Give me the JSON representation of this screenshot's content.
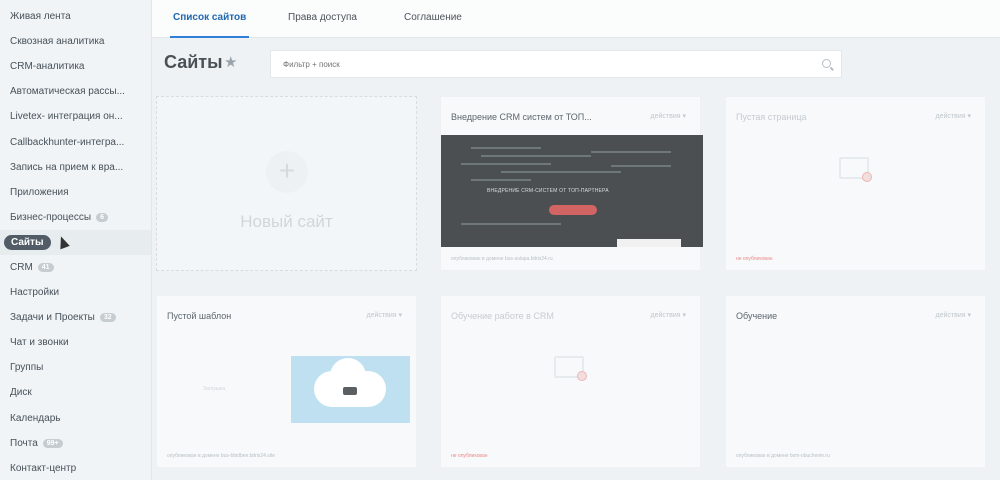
{
  "sidebar": {
    "items": [
      {
        "label": "Живая лента"
      },
      {
        "label": "Сквозная аналитика"
      },
      {
        "label": "CRM-аналитика"
      },
      {
        "label": "Автоматическая рассы..."
      },
      {
        "label": "Livetex- интеграция он..."
      },
      {
        "label": "Callbackhunter-интегра..."
      },
      {
        "label": "Запись на прием к вра..."
      },
      {
        "label": "Приложения"
      },
      {
        "label": "Бизнес-процессы",
        "badge": "6"
      },
      {
        "label": "Сайты"
      },
      {
        "label": "CRM",
        "badge": "41"
      },
      {
        "label": "Настройки"
      },
      {
        "label": "Задачи и Проекты",
        "badge": "32"
      },
      {
        "label": "Чат и звонки"
      },
      {
        "label": "Группы"
      },
      {
        "label": "Диск"
      },
      {
        "label": "Календарь"
      },
      {
        "label": "Почта",
        "badge": "99+"
      },
      {
        "label": "Контакт-центр"
      }
    ]
  },
  "tabs": {
    "list": "Список сайтов",
    "access": "Права доступа",
    "agreement": "Соглашение"
  },
  "page": {
    "title": "Сайты",
    "search_placeholder": "Фильтр + поиск"
  },
  "cards": {
    "new_site": "Новый сайт",
    "c1": {
      "title": "Внедрение CRM систем от ТОП...",
      "actions": "действия",
      "preview_text": "ВНЕДРЕНИЕ CRM-СИСТЕМ ОТ ТОП-ПАРТНЕРА",
      "footer": "опубликован в домене bus-sulapa.bitrix24.ru"
    },
    "c2": {
      "title": "Пустая страница",
      "actions": "действия",
      "footer": "не опубликован"
    },
    "c3": {
      "title": "Пустой шаблон",
      "actions": "действия",
      "placeholder": "Заглушка",
      "footer": "опубликован в домене bus-bbidbee.bitrix24.site"
    },
    "c4": {
      "title": "Обучение работе в CRM",
      "actions": "действия",
      "footer": "не опубликован"
    },
    "c5": {
      "title": "Обучение",
      "actions": "действия",
      "footer": "опубликован в домене bxm-obuchenie.ru"
    }
  },
  "colors": {
    "accent": "#2f7ed8",
    "active_item_bg": "#515c66",
    "warn": "#e88b8b"
  }
}
